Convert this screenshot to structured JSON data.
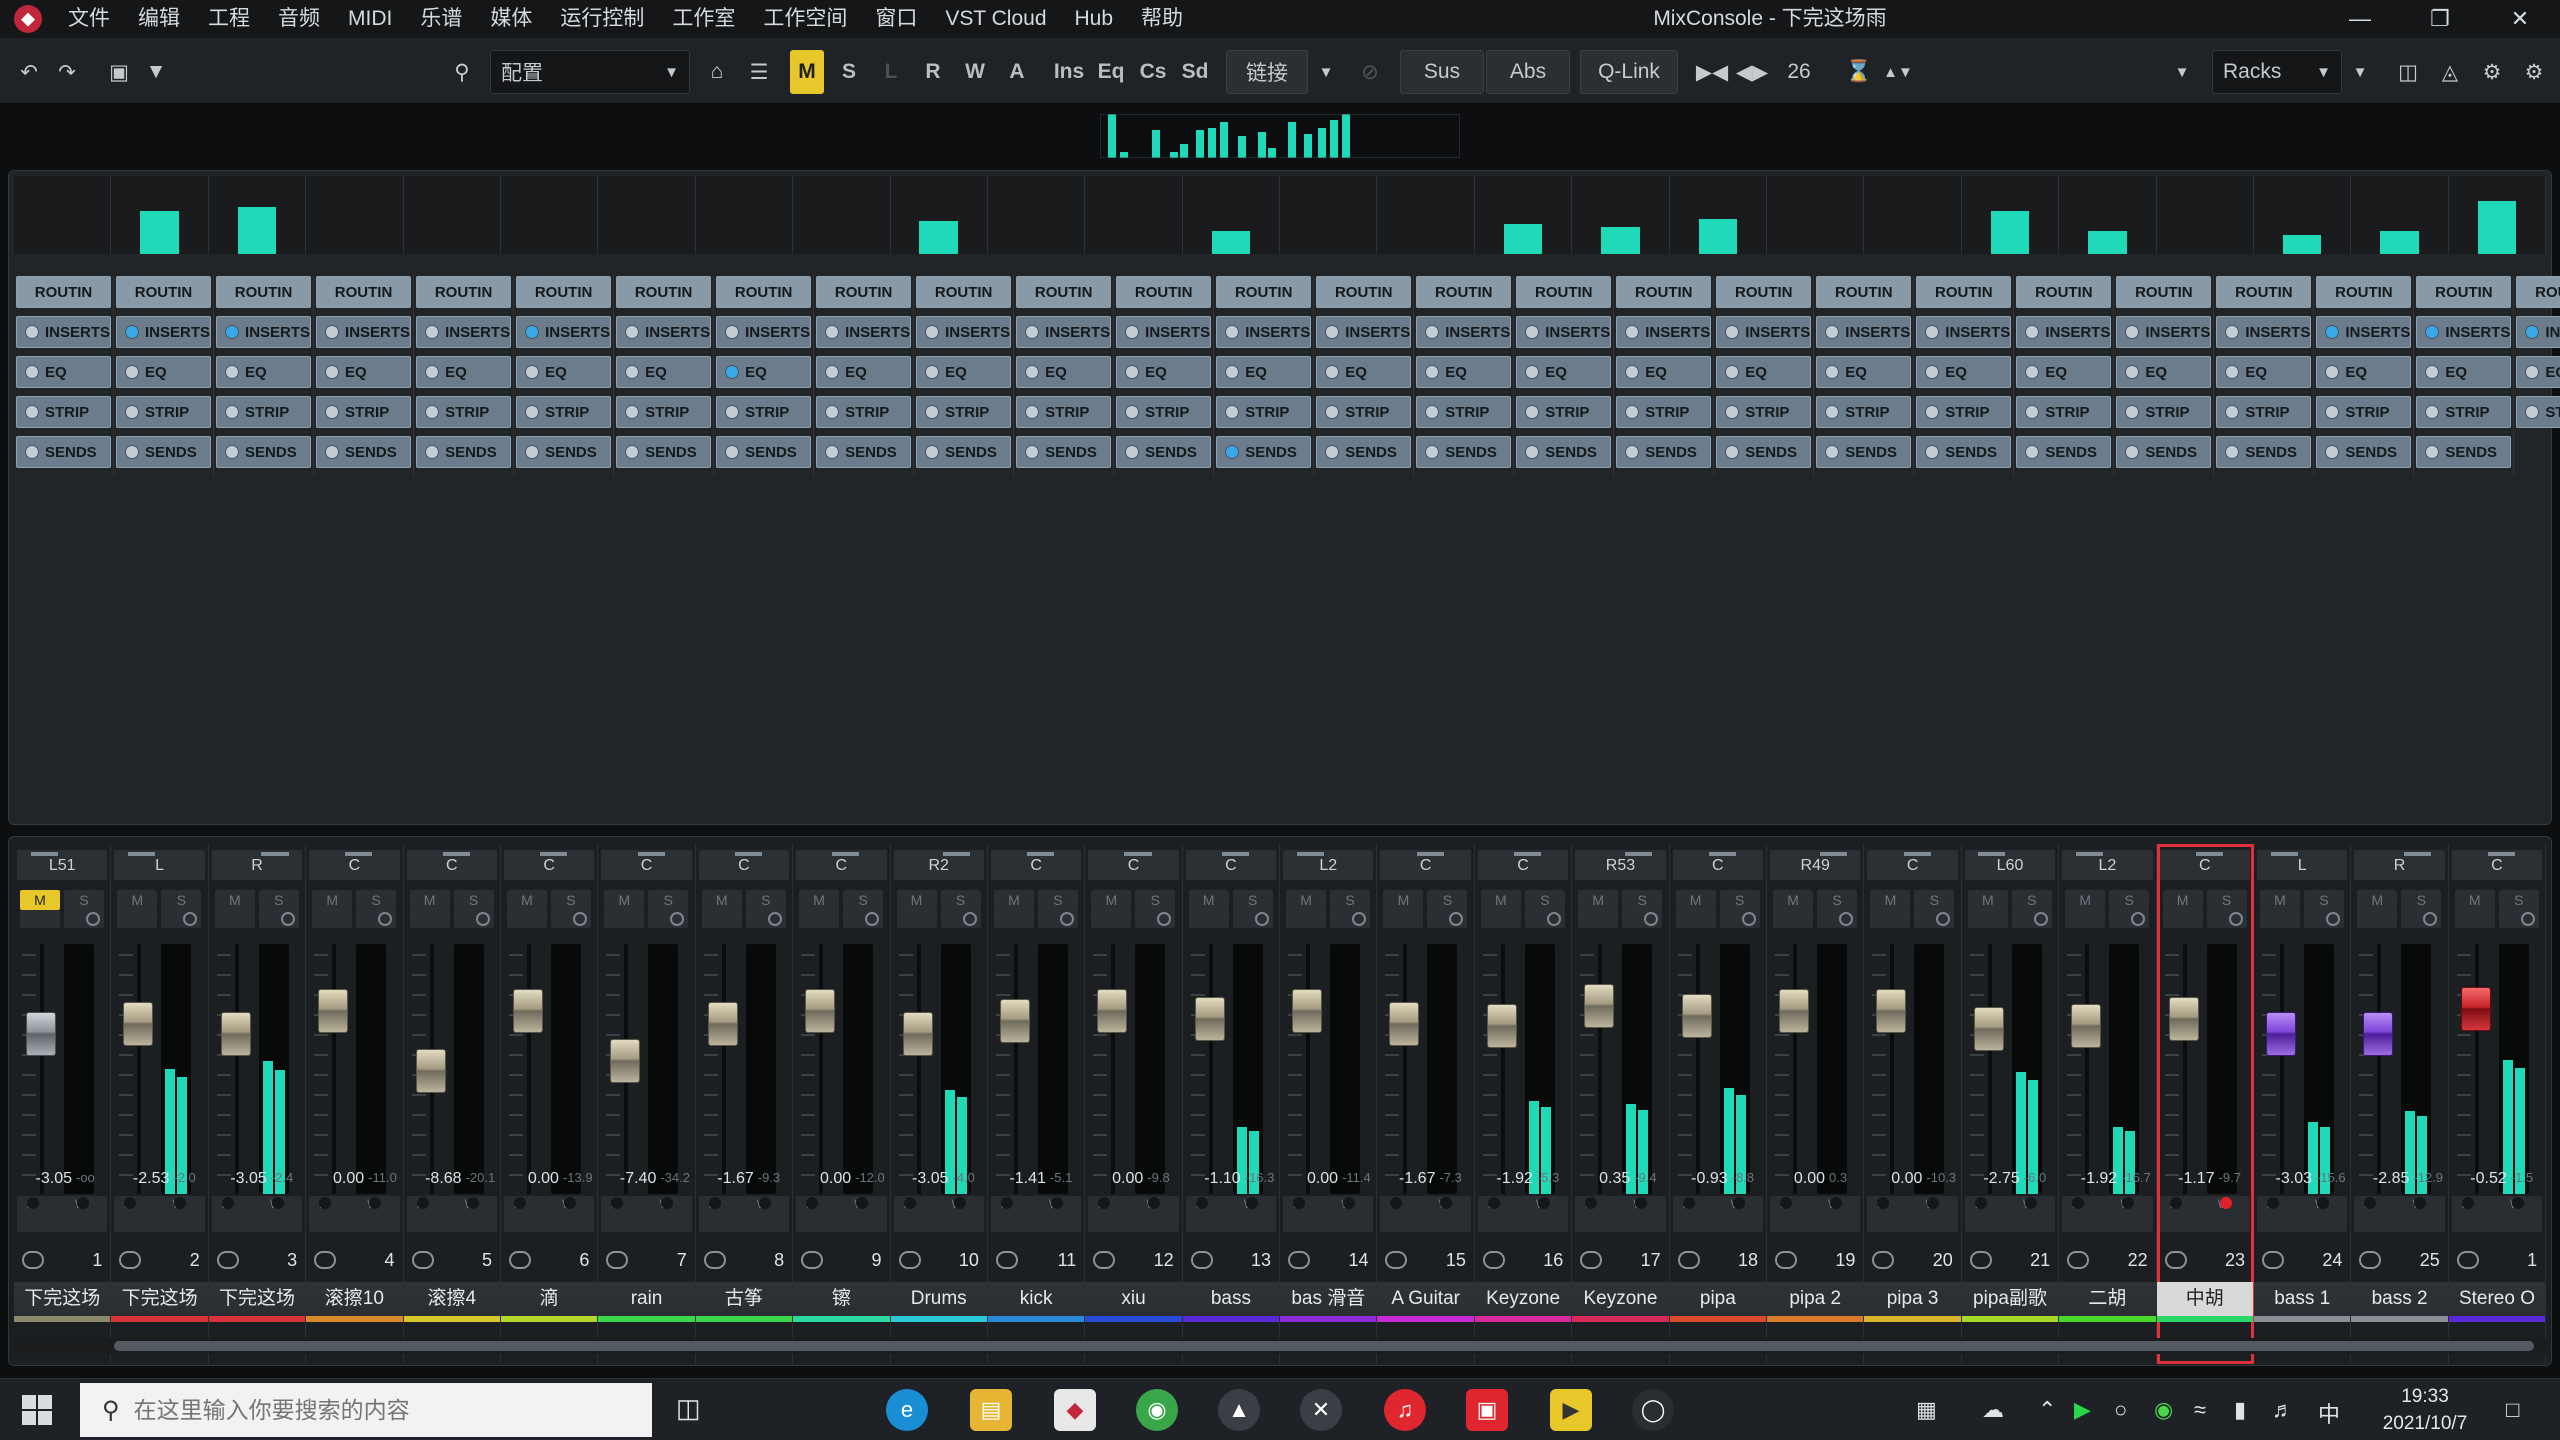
{
  "app": {
    "title": "MixConsole - 下完这场雨"
  },
  "menu": [
    "文件",
    "编辑",
    "工程",
    "音频",
    "MIDI",
    "乐谱",
    "媒体",
    "运行控制",
    "工作室",
    "工作空间",
    "窗口",
    "VST Cloud",
    "Hub",
    "帮助"
  ],
  "toolbar": {
    "config_label": "配置",
    "mode_buttons": [
      "M",
      "S",
      "L",
      "R",
      "W",
      "A"
    ],
    "section_buttons": [
      "Ins",
      "Eq",
      "Cs",
      "Sd"
    ],
    "link_label": "链接",
    "sus_label": "Sus",
    "abs_label": "Abs",
    "qlink_label": "Q-Link",
    "channel_width": "26",
    "racks_label": "Racks"
  },
  "racks": {
    "routing": "ROUTIN",
    "inserts": "INSERTS",
    "eq": "EQ",
    "strip": "STRIP",
    "sends": "SENDS"
  },
  "channels": [
    {
      "pan": "L51",
      "vol": "-3.05",
      "peak": "-oo",
      "num": "1",
      "name": "下完这场",
      "color": "#8a8a6a",
      "top_meter": 0.0,
      "lvl": 0.0,
      "fader": 0.25,
      "mute": true,
      "ins_on": false,
      "eq_on": false,
      "sends_on": false
    },
    {
      "pan": "L",
      "vol": "-2.53",
      "peak": "-2.0",
      "num": "2",
      "name": "下完这场",
      "color": "#d8323a",
      "top_meter": 0.55,
      "lvl": 0.78,
      "fader": 0.29,
      "ins_on": true,
      "eq_on": false,
      "sends_on": false
    },
    {
      "pan": "R",
      "vol": "-3.05",
      "peak": "-2.4",
      "num": "3",
      "name": "下完这场",
      "color": "#d8323a",
      "top_meter": 0.6,
      "lvl": 0.83,
      "fader": 0.25,
      "ins_on": true,
      "eq_on": false,
      "sends_on": false
    },
    {
      "pan": "C",
      "vol": "0.00",
      "peak": "-11.0",
      "num": "4",
      "name": "滚擦10",
      "color": "#d88a2a",
      "top_meter": 0.0,
      "lvl": 0.0,
      "fader": 0.34,
      "ins_on": false,
      "eq_on": false,
      "sends_on": false
    },
    {
      "pan": "C",
      "vol": "-8.68",
      "peak": "-20.1",
      "num": "5",
      "name": "滚擦4",
      "color": "#d8c82a",
      "top_meter": 0.0,
      "lvl": 0.0,
      "fader": 0.1,
      "ins_on": false,
      "eq_on": false,
      "sends_on": false
    },
    {
      "pan": "C",
      "vol": "0.00",
      "peak": "-13.9",
      "num": "6",
      "name": "滴",
      "color": "#b4d82a",
      "top_meter": 0.0,
      "lvl": 0.0,
      "fader": 0.34,
      "ins_on": true,
      "eq_on": false,
      "sends_on": false
    },
    {
      "pan": "C",
      "vol": "-7.40",
      "peak": "-34.2",
      "num": "7",
      "name": "rain",
      "color": "#3ad84a",
      "top_meter": 0.0,
      "lvl": 0.0,
      "fader": 0.14,
      "ins_on": false,
      "eq_on": false,
      "sends_on": false
    },
    {
      "pan": "C",
      "vol": "-1.67",
      "peak": "-9.3",
      "num": "8",
      "name": "古筝",
      "color": "#3ad84a",
      "top_meter": 0.0,
      "lvl": 0.0,
      "fader": 0.29,
      "ins_on": false,
      "eq_on": true,
      "sends_on": false
    },
    {
      "pan": "C",
      "vol": "0.00",
      "peak": "-12.0",
      "num": "9",
      "name": "镲",
      "color": "#2ad8a0",
      "top_meter": 0.0,
      "lvl": 0.0,
      "fader": 0.34,
      "ins_on": false,
      "eq_on": false,
      "sends_on": false
    },
    {
      "pan": "R2",
      "vol": "-3.05",
      "peak": "-4.0",
      "num": "10",
      "name": "Drums",
      "color": "#2ac8d8",
      "top_meter": 0.42,
      "lvl": 0.65,
      "fader": 0.25,
      "ins_on": false,
      "eq_on": false,
      "sends_on": false
    },
    {
      "pan": "C",
      "vol": "-1.41",
      "peak": "-5.1",
      "num": "11",
      "name": "kick",
      "color": "#2a8ad8",
      "top_meter": 0.0,
      "lvl": 0.0,
      "fader": 0.3,
      "ins_on": false,
      "eq_on": false,
      "sends_on": false
    },
    {
      "pan": "C",
      "vol": "0.00",
      "peak": "-9.8",
      "num": "12",
      "name": "xiu",
      "color": "#2a4ad8",
      "top_meter": 0.0,
      "lvl": 0.0,
      "fader": 0.34,
      "ins_on": false,
      "eq_on": false,
      "sends_on": false
    },
    {
      "pan": "C",
      "vol": "-1.10",
      "peak": "-16.3",
      "num": "13",
      "name": "bass",
      "color": "#5a2ad8",
      "top_meter": 0.3,
      "lvl": 0.42,
      "fader": 0.31,
      "ins_on": false,
      "eq_on": false,
      "sends_on": true
    },
    {
      "pan": "L2",
      "vol": "0.00",
      "peak": "-11.4",
      "num": "14",
      "name": "bas 滑音",
      "color": "#8a2ad8",
      "top_meter": 0.0,
      "lvl": 0.0,
      "fader": 0.34,
      "ins_on": false,
      "eq_on": false,
      "sends_on": false
    },
    {
      "pan": "C",
      "vol": "-1.67",
      "peak": "-7.3",
      "num": "15",
      "name": "A Guitar",
      "color": "#c82ad8",
      "top_meter": 0.0,
      "lvl": 0.0,
      "fader": 0.29,
      "ins_on": false,
      "eq_on": false,
      "sends_on": false
    },
    {
      "pan": "C",
      "vol": "-1.92",
      "peak": "-5.3",
      "num": "16",
      "name": "Keyzone",
      "color": "#d82a9a",
      "top_meter": 0.38,
      "lvl": 0.58,
      "fader": 0.28,
      "ins_on": false,
      "eq_on": false,
      "sends_on": false
    },
    {
      "pan": "R53",
      "vol": "0.35",
      "peak": "-9.4",
      "num": "17",
      "name": "Keyzone",
      "color": "#d82a5a",
      "top_meter": 0.35,
      "lvl": 0.56,
      "fader": 0.36,
      "ins_on": false,
      "eq_on": false,
      "sends_on": false
    },
    {
      "pan": "C",
      "vol": "-0.93",
      "peak": "-8.8",
      "num": "18",
      "name": "pipa",
      "color": "#d84a2a",
      "top_meter": 0.45,
      "lvl": 0.66,
      "fader": 0.32,
      "ins_on": false,
      "eq_on": false,
      "sends_on": false
    },
    {
      "pan": "R49",
      "vol": "0.00",
      "peak": "0.3",
      "num": "19",
      "name": "pipa 2",
      "color": "#d87a2a",
      "top_meter": 0.0,
      "lvl": 0.0,
      "fader": 0.34,
      "ins_on": false,
      "eq_on": false,
      "sends_on": false
    },
    {
      "pan": "C",
      "vol": "0.00",
      "peak": "-10.3",
      "num": "20",
      "name": "pipa 3",
      "color": "#d8b42a",
      "top_meter": 0.0,
      "lvl": 0.0,
      "fader": 0.34,
      "ins_on": false,
      "eq_on": false,
      "sends_on": false
    },
    {
      "pan": "L60",
      "vol": "-2.75",
      "peak": "-6.0",
      "num": "21",
      "name": "pipa副歌",
      "color": "#a8d82a",
      "top_meter": 0.55,
      "lvl": 0.76,
      "fader": 0.27,
      "ins_on": false,
      "eq_on": false,
      "sends_on": false
    },
    {
      "pan": "L2",
      "vol": "-1.92",
      "peak": "-16.7",
      "num": "22",
      "name": "二胡",
      "color": "#4ad82a",
      "top_meter": 0.3,
      "lvl": 0.42,
      "fader": 0.28,
      "ins_on": false,
      "eq_on": false,
      "sends_on": false
    },
    {
      "pan": "C",
      "vol": "-1.17",
      "peak": "-9.7",
      "num": "23",
      "name": "中胡",
      "color": "#2ad86a",
      "top_meter": 0.0,
      "lvl": 0.0,
      "fader": 0.31,
      "selected": true,
      "rec": true,
      "ins_on": false,
      "eq_on": false,
      "sends_on": false
    },
    {
      "pan": "L",
      "vol": "-3.03",
      "peak": "-15.6",
      "num": "24",
      "name": "bass 1",
      "color": "#8a8f95",
      "top_meter": 0.25,
      "lvl": 0.45,
      "fader": 0.25,
      "cap": "purple",
      "ins_on": true,
      "eq_on": false,
      "sends_on": false
    },
    {
      "pan": "R",
      "vol": "-2.85",
      "peak": "-12.9",
      "num": "25",
      "name": "bass 2",
      "color": "#8a8f95",
      "top_meter": 0.3,
      "lvl": 0.52,
      "fader": 0.25,
      "cap": "purple",
      "ins_on": true,
      "eq_on": false,
      "sends_on": false
    },
    {
      "pan": "C",
      "vol": "-0.52",
      "peak": "-1.5",
      "num": "1",
      "name": "Stereo O",
      "color": "#5a2ad8",
      "top_meter": 0.68,
      "lvl": 0.84,
      "fader": 0.35,
      "cap": "red",
      "ins_on": true,
      "eq_on": false,
      "sends_on": false,
      "no_sends": true
    }
  ],
  "taskbar": {
    "search_placeholder": "在这里输入你要搜索的内容",
    "time": "19:33",
    "date": "2021/10/7",
    "ime": "中"
  },
  "colors": {
    "accent_yellow": "#e8c72a",
    "meter_teal": "#1fd9b8",
    "selected_red": "#e0303a"
  }
}
